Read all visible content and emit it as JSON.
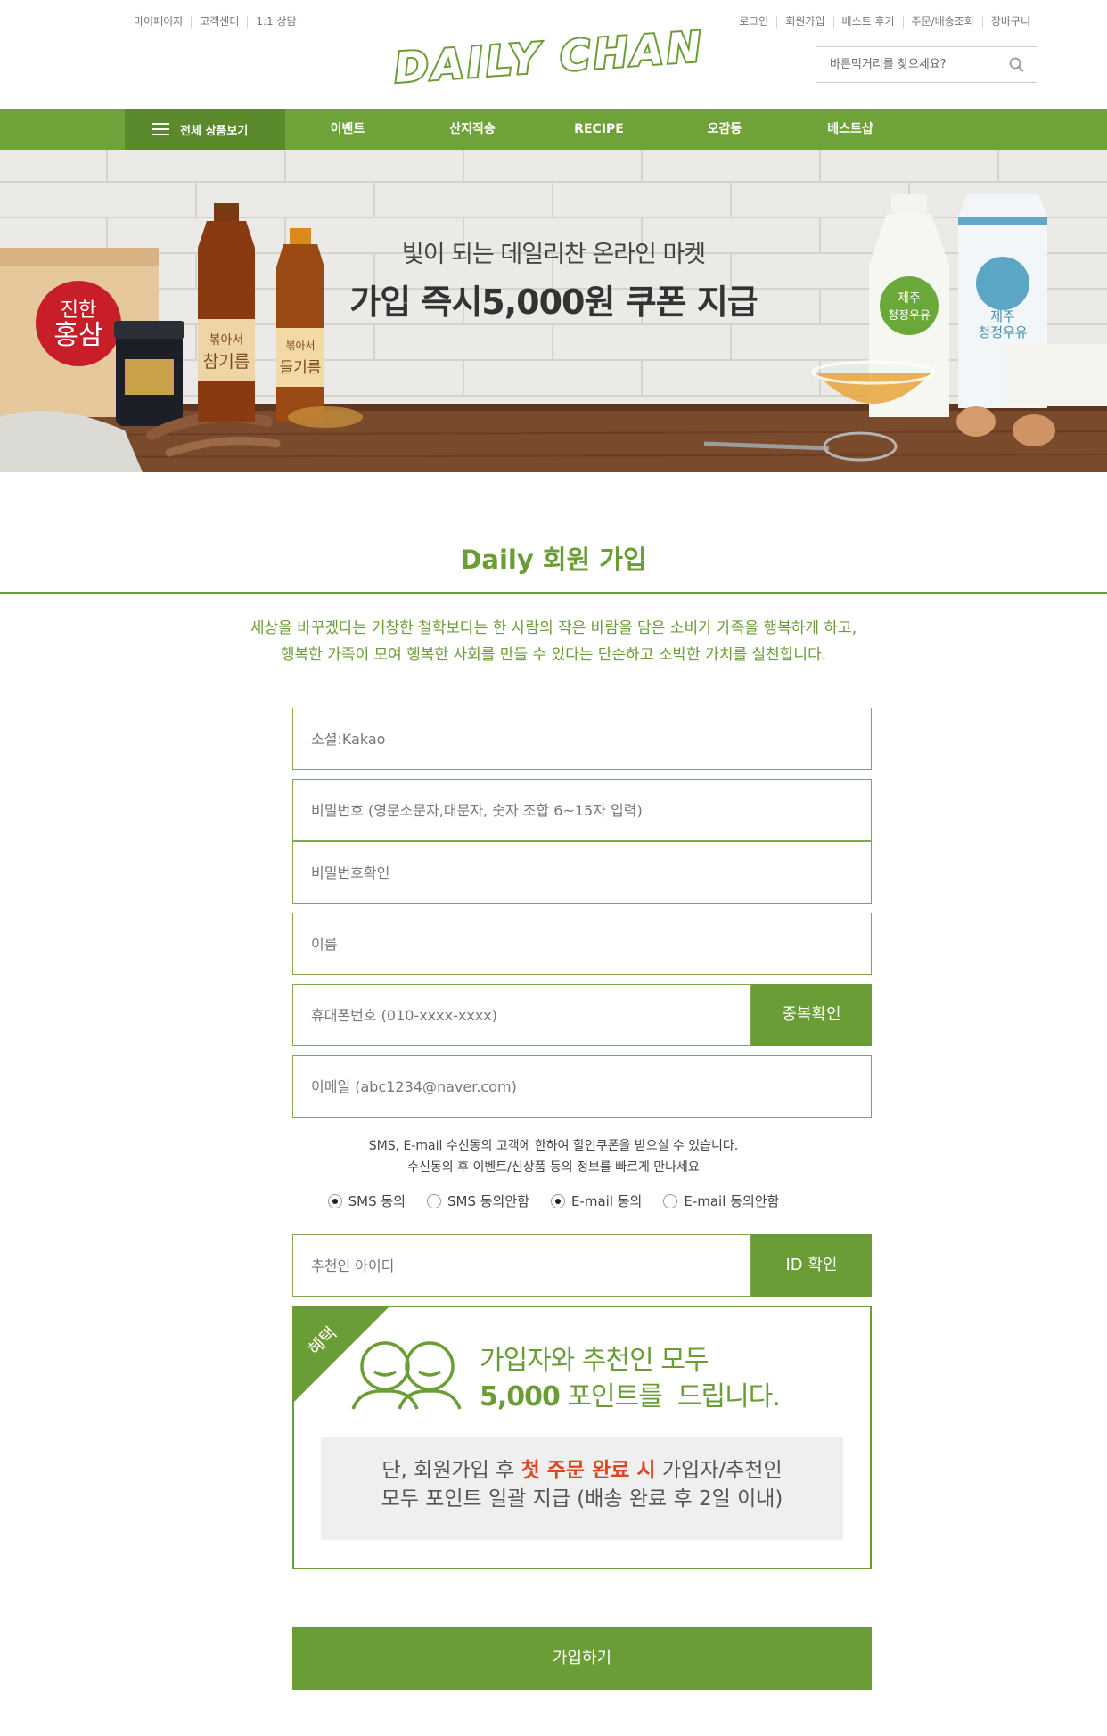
{
  "header": {
    "util_left": [
      "마이페이지",
      "고객센터",
      "1:1 상담"
    ],
    "util_right": [
      "로그인",
      "회원가입",
      "베스트 후기",
      "주문/배송조회",
      "장바구니"
    ],
    "logo_text": "DAILY CHAN",
    "search": {
      "placeholder": "바른먹거리를 찾으세요?"
    }
  },
  "nav": {
    "all_products": "전체 상품보기",
    "items": [
      "이벤트",
      "산지직송",
      "RECIPE",
      "오감동",
      "베스트샵"
    ]
  },
  "banner": {
    "line1": "빛이 되는 데일리찬 온라인 마켓",
    "line2": "가입 즉시5,000원 쿠폰 지급",
    "product_labels": {
      "ginseng_box_1": "진한",
      "ginseng_box_2": "홍삼",
      "sesame_oil_1": "볶아서",
      "sesame_oil_2": "참기름",
      "perilla_oil_1": "볶아서",
      "perilla_oil_2": "들기름",
      "milk_bottle_1": "제주",
      "milk_bottle_2": "청정우유",
      "milk_carton_1": "제주",
      "milk_carton_2": "청정우유"
    }
  },
  "page": {
    "title": "Daily 회원 가입",
    "intro_line1": "세상을 바꾸겠다는 거창한 철학보다는 한 사람의 작은 바람을 담은 소비가 가족을 행복하게 하고,",
    "intro_line2": "행복한 가족이 모여 행복한 사회를 만들 수 있다는 단순하고 소박한 가치를 실천합니다."
  },
  "form": {
    "social": {
      "placeholder": "소셜:Kakao"
    },
    "password": {
      "placeholder": "비밀번호 (영문소문자,대문자, 숫자 조합 6~15자 입력)"
    },
    "password_confirm": {
      "placeholder": "비밀번호확인"
    },
    "name": {
      "placeholder": "이름"
    },
    "phone": {
      "placeholder": "휴대폰번호 (010-xxxx-xxxx)"
    },
    "phone_check_button": "중복확인",
    "email": {
      "placeholder": "이메일 (abc1234@naver.com)"
    },
    "notice_line1": "SMS, E-mail 수신동의 고객에 한하여 할인쿠폰을 받으실 수 있습니다.",
    "notice_line2": "수신동의 후 이벤트/신상품 등의 정보를 빠르게 만나세요",
    "radios": [
      {
        "label": "SMS 동의",
        "checked": true
      },
      {
        "label": "SMS 동의안함",
        "checked": false
      },
      {
        "label": "E-mail 동의",
        "checked": true
      },
      {
        "label": "E-mail 동의안함",
        "checked": false
      }
    ],
    "referrer": {
      "placeholder": "추천인 아이디"
    },
    "referrer_check_button": "ID 확인",
    "submit_button": "가입하기"
  },
  "benefit": {
    "tag": "혜택",
    "line1": "가입자와 추천인 모두",
    "line2_amount": "5,000",
    "line2_rest": " 포인트를  드립니다.",
    "note_line1_pre": "단, 회원가입 후 ",
    "note_line1_highlight": "첫 주문 완료 시",
    "note_line1_post": " 가입자/추천인",
    "note_line2": "모두 포인트 일괄 지급 (배송 완료 후 2일 이내)"
  },
  "colors": {
    "brand_green": "#6b9d36",
    "nav_green": "#70a23a",
    "nav_dark_green": "#5a8a2b",
    "highlight_red": "#d9461f"
  }
}
